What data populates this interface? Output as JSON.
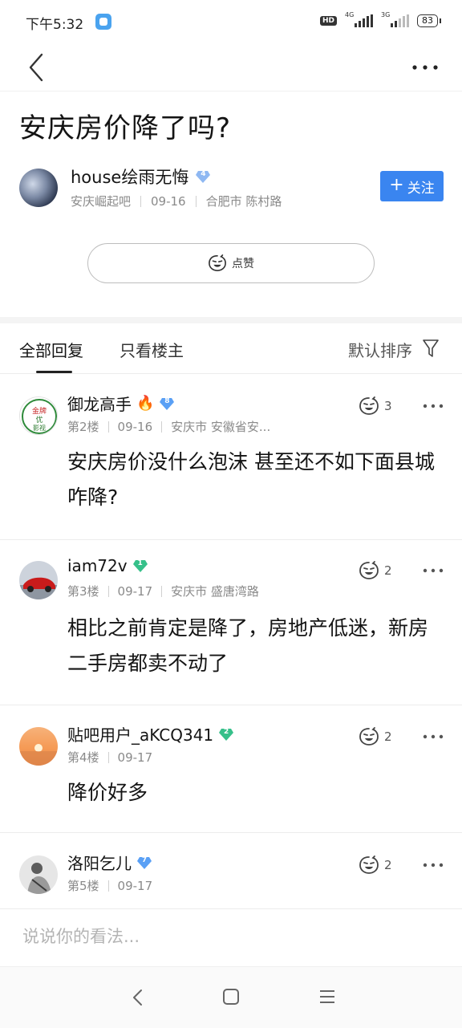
{
  "status_bar": {
    "time": "下午5:32",
    "hd": "HD",
    "net1": "4G",
    "net2": "3G",
    "battery": "83"
  },
  "post": {
    "title": "安庆房价降了吗?",
    "author": {
      "name": "house绘雨无悔",
      "level": "4",
      "bar": "安庆崛起吧",
      "date": "09-16",
      "location": "合肥市 陈村路"
    },
    "follow_label": "关注",
    "like_label": "点赞"
  },
  "tabs": {
    "all": "全部回复",
    "owner_only": "只看楼主",
    "sort": "默认排序"
  },
  "replies": [
    {
      "name": "御龙高手",
      "has_fire": true,
      "level": "8",
      "level_color": "#5aa0f5",
      "floor": "第2楼",
      "date": "09-16",
      "location": "安庆市 安徽省安...",
      "likes": "3",
      "content": "安庆房价没什么泡沫 甚至还不如下面县城 咋降?"
    },
    {
      "name": "iam72v",
      "has_fire": false,
      "level": "1",
      "level_color": "#36c08a",
      "floor": "第3楼",
      "date": "09-17",
      "location": "安庆市 盛唐湾路",
      "likes": "2",
      "content": "相比之前肯定是降了，房地产低迷，新房二手房都卖不动了"
    },
    {
      "name": "贴吧用户_aKCQ341",
      "has_fire": false,
      "level": "2",
      "level_color": "#36c08a",
      "floor": "第4楼",
      "date": "09-17",
      "location": "",
      "likes": "2",
      "content": "降价好多"
    },
    {
      "name": "洛阳乞儿",
      "has_fire": false,
      "level": "7",
      "level_color": "#5aa0f5",
      "floor": "第5楼",
      "date": "09-17",
      "location": "",
      "likes": "2",
      "content": ""
    }
  ],
  "comment_placeholder": "说说你的看法..."
}
